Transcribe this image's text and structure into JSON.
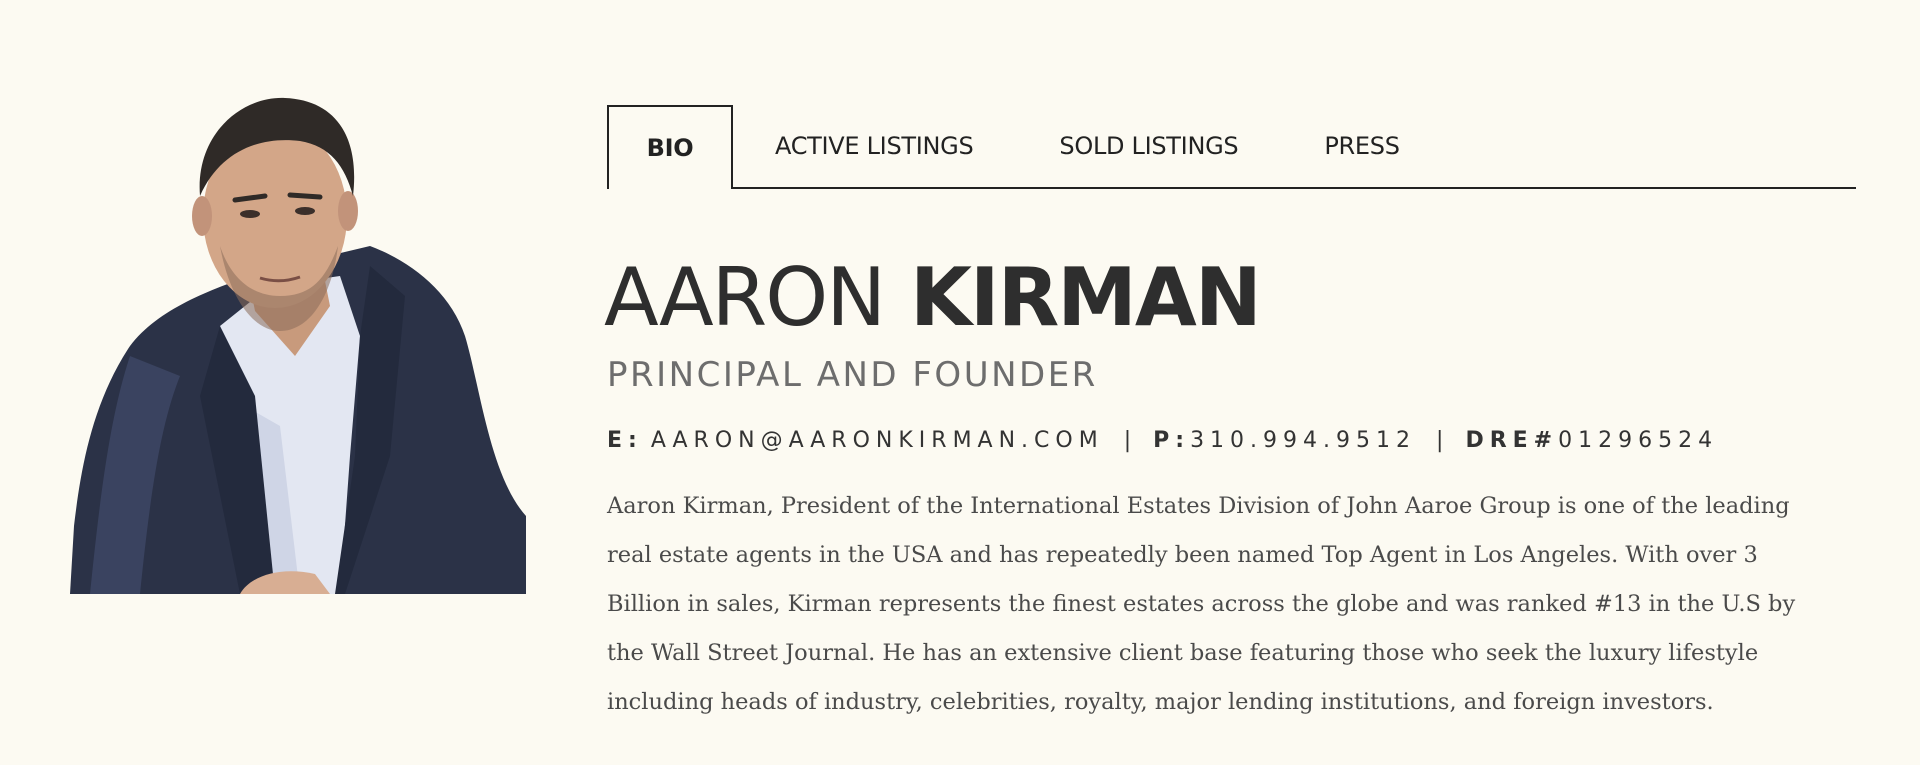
{
  "portrait": {
    "alt": "Aaron Kirman portrait"
  },
  "tabs": [
    {
      "label": "BIO",
      "active": true
    },
    {
      "label": "ACTIVE LISTINGS",
      "active": false
    },
    {
      "label": "SOLD LISTINGS",
      "active": false
    },
    {
      "label": "PRESS",
      "active": false
    }
  ],
  "profile": {
    "first_name": "AARON",
    "last_name": "KIRMAN",
    "title": "PRINCIPAL AND FOUNDER"
  },
  "contact": {
    "email_label": "E:",
    "email": "AARON@AARONKIRMAN.COM",
    "separator": "|",
    "phone_label": "P:",
    "phone": "310.994.9512",
    "dre_label": "DRE#",
    "dre": "01296524"
  },
  "bio": "Aaron Kirman, President of the International Estates Division of John Aaroe Group is one of the leading real estate agents in the USA and has repeatedly been named Top Agent in Los Angeles. With over 3 Billion in sales, Kirman represents the finest estates across the globe and was ranked #13 in the U.S by the Wall Street Journal. He has an extensive client base featuring those who seek the luxury lifestyle including heads of industry, celebrities, royalty, major lending institutions, and foreign investors.",
  "colors": {
    "background": "#fcfaf2",
    "text": "#2e2e2e",
    "muted": "#6d6d6d",
    "jacket": "#2b3247",
    "shirt": "#e3e7f2"
  }
}
